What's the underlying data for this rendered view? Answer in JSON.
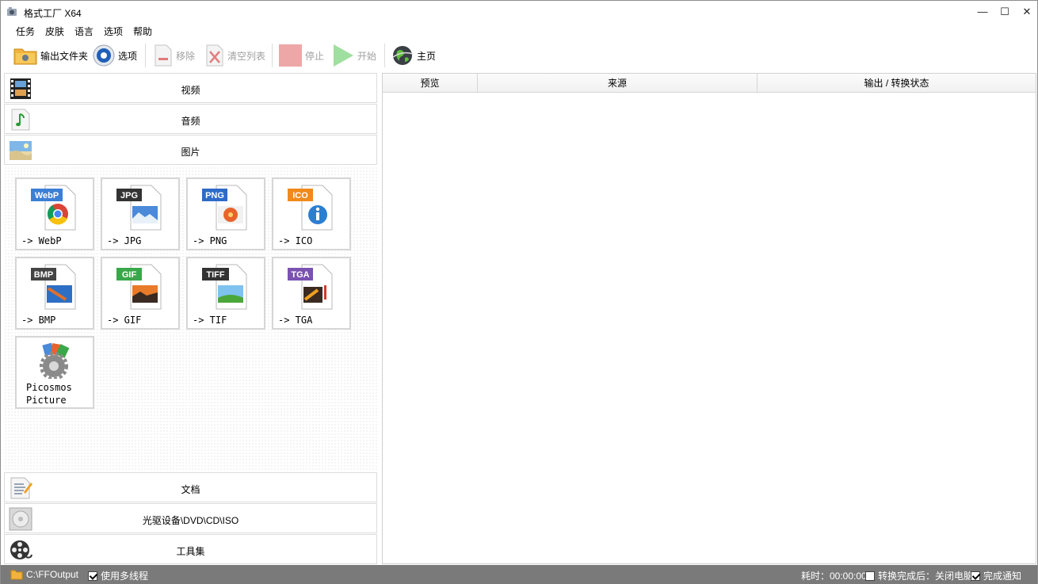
{
  "window": {
    "title": "格式工厂 X64",
    "minimize": "—",
    "maximize": "☐",
    "close": "✕"
  },
  "menu": [
    "任务",
    "皮肤",
    "语言",
    "选项",
    "帮助"
  ],
  "toolbar": {
    "output_folder": "输出文件夹",
    "options": "选项",
    "remove": "移除",
    "clear_list": "清空列表",
    "stop": "停止",
    "start": "开始",
    "home": "主页"
  },
  "categories": {
    "video": "视频",
    "audio": "音频",
    "image": "图片",
    "document": "文档",
    "optical": "光驱设备\\DVD\\CD\\ISO",
    "tools": "工具集"
  },
  "image_formats": [
    {
      "badge": "WebP",
      "label": "-> WebP",
      "color": "#3b7fd6"
    },
    {
      "badge": "JPG",
      "label": "-> JPG",
      "color": "#333333"
    },
    {
      "badge": "PNG",
      "label": "-> PNG",
      "color": "#2e6bc9"
    },
    {
      "badge": "ICO",
      "label": "-> ICO",
      "color": "#f08a1c"
    },
    {
      "badge": "BMP",
      "label": "-> BMP",
      "color": "#444444"
    },
    {
      "badge": "GIF",
      "label": "-> GIF",
      "color": "#3aa84a"
    },
    {
      "badge": "TIFF",
      "label": "-> TIF",
      "color": "#333333"
    },
    {
      "badge": "TGA",
      "label": "-> TGA",
      "color": "#7b52b0"
    }
  ],
  "picosmos": {
    "line1": "Picosmos",
    "line2": "Picture"
  },
  "task_table": {
    "columns": [
      "预览",
      "来源",
      "输出 / 转换状态"
    ]
  },
  "status": {
    "output_path": "C:\\FFOutput",
    "multithread": "使用多线程",
    "multithread_checked": true,
    "elapsed": "耗时：00:00:00",
    "after_convert": "转换完成后：关闭电脑",
    "after_convert_checked": false,
    "notify": "完成通知",
    "notify_checked": true
  }
}
